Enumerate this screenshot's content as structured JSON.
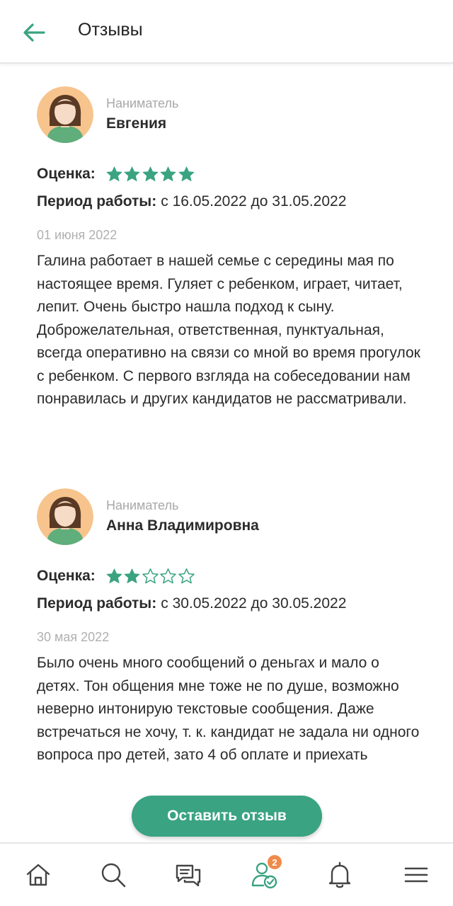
{
  "header": {
    "title": "Отзывы",
    "back_icon": "arrow-left-icon"
  },
  "colors": {
    "accent": "#3aa381",
    "star": "#3aa381",
    "badge": "#f08a4b",
    "muted_text": "#a8a8a8"
  },
  "labels": {
    "rating": "Оценка:",
    "period": "Период работы:"
  },
  "reviews": [
    {
      "role": "Наниматель",
      "name": "Евгения",
      "rating": 5,
      "rating_max": 5,
      "period": "с 16.05.2022 до 31.05.2022",
      "date": "01 июня 2022",
      "text": "Галина работает в нашей семье с середины мая по настоящее время. Гуляет с ребенком, играет, читает, лепит. Очень быстро нашла подход к сыну. Доброжелательная, ответственная, пунктуальная, всегда оперативно на связи со мной во время прогулок с ребенком. С первого взгляда на собеседовании нам понравилась и других кандидатов не рассматривали."
    },
    {
      "role": "Наниматель",
      "name": "Анна Владимировна",
      "rating": 2,
      "rating_max": 5,
      "period": "с 30.05.2022 до 30.05.2022",
      "date": "30 мая 2022",
      "text": "Было очень много сообщений о деньгах и мало о детях. Тон общения мне тоже не по душе, возможно неверно интонирую текстовые сообщения. Даже встречаться не хочу, т. к. кандидат не задала ни одного вопроса про детей, зато 4 об оплате и приехать"
    }
  ],
  "actions": {
    "leave_review": "Оставить отзыв"
  },
  "bottom_nav": {
    "items": [
      {
        "icon": "home-icon"
      },
      {
        "icon": "search-icon"
      },
      {
        "icon": "chat-icon"
      },
      {
        "icon": "candidates-icon",
        "badge": "2"
      },
      {
        "icon": "bell-icon"
      },
      {
        "icon": "menu-icon"
      }
    ]
  }
}
